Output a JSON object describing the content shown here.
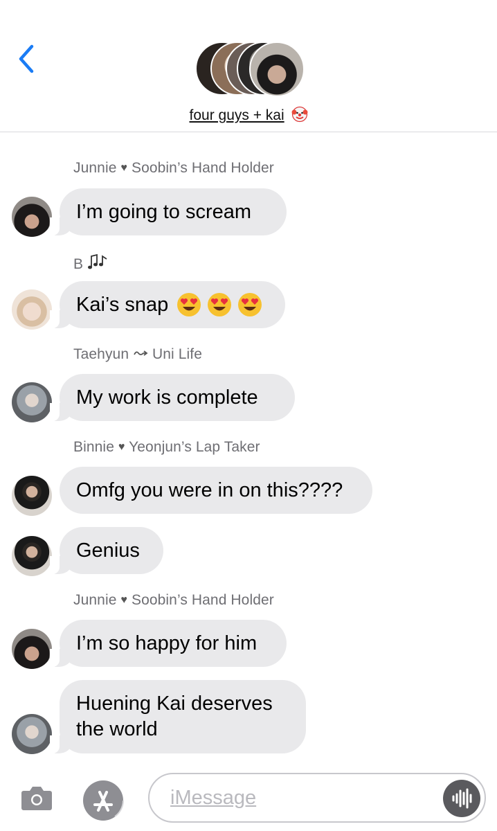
{
  "header": {
    "group_name": "four guys + kai",
    "group_emoji": "clown-face-emoji"
  },
  "colors": {
    "accent": "#1a7cf5",
    "bubble_received": "#e9e9eb",
    "sender_label": "#6e6e73"
  },
  "messages": [
    {
      "sender": "Junnie",
      "sender_tail": "Soobin’s Hand Holder",
      "sender_icon": "heart",
      "text": "I’m going to scream"
    },
    {
      "sender": "B",
      "sender_icon": "music-notes",
      "text": "Kai’s snap",
      "emojis": [
        "heart-eyes-emoji",
        "heart-eyes-emoji",
        "heart-eyes-emoji"
      ]
    },
    {
      "sender": "Taehyun",
      "sender_tail": "Uni Life",
      "sender_icon": "curly-arrow",
      "text": "My work is complete"
    },
    {
      "sender": "Binnie",
      "sender_tail": "Yeonjun’s Lap Taker",
      "sender_icon": "heart",
      "text": "Omfg you were in on this????"
    },
    {
      "text": "Genius"
    },
    {
      "sender": "Junnie",
      "sender_tail": "Soobin’s Hand Holder",
      "sender_icon": "heart",
      "text": "I’m so happy for him"
    },
    {
      "text": "Huening Kai deserves\nthe world"
    }
  ],
  "composer": {
    "placeholder": "iMessage",
    "camera_icon": "camera-icon",
    "apps_icon": "app-store-icon",
    "audio_icon": "audio-waveform-icon"
  }
}
